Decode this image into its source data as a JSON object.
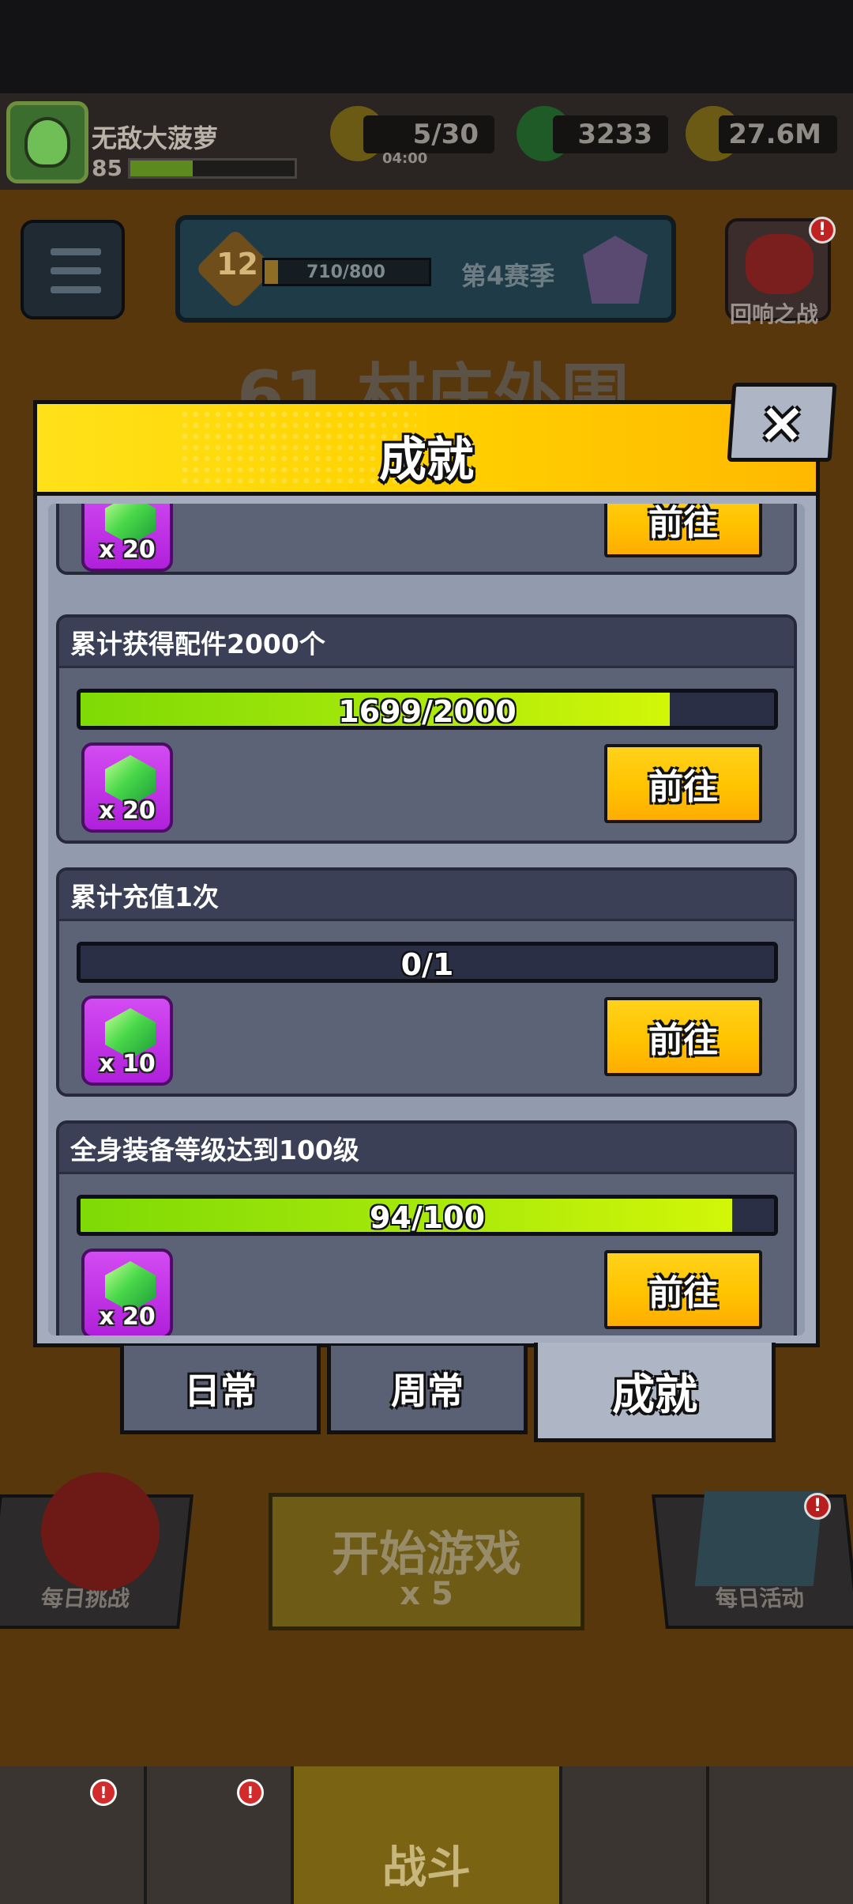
{
  "player": {
    "name": "无敌大菠萝",
    "level": "85"
  },
  "resources": {
    "energy": "5/30",
    "energy_timer": "04:00",
    "gems": "3233",
    "gold": "27.6M"
  },
  "season": {
    "rank": "12",
    "progress": "710/800",
    "name": "第4赛季"
  },
  "echo_battle": {
    "label": "回响之战",
    "badge": "!"
  },
  "stage": {
    "title": "61.村庄外围"
  },
  "side_buttons": {
    "daily_challenge": "每日挑战",
    "daily_activity": "每日活动",
    "badge": "!"
  },
  "start_game": {
    "label": "开始游戏",
    "cost": "x 5"
  },
  "bottom_nav": {
    "fight_label": "战斗",
    "badge": "!"
  },
  "modal": {
    "title": "成就",
    "close_symbol": "×",
    "go_label": "前往",
    "partial_item": {
      "reward_qty": "x 20"
    },
    "items": [
      {
        "title": "累计获得配件2000个",
        "progress_text": "1699/2000",
        "progress": 0.8495,
        "reward_qty": "x 20"
      },
      {
        "title": "累计充值1次",
        "progress_text": "0/1",
        "progress": 0,
        "reward_qty": "x 10"
      },
      {
        "title": "全身装备等级达到100级",
        "progress_text": "94/100",
        "progress": 0.94,
        "reward_qty": "x 20"
      }
    ]
  },
  "tabs": {
    "daily": "日常",
    "weekly": "周常",
    "achievement": "成就",
    "active": "achievement"
  }
}
